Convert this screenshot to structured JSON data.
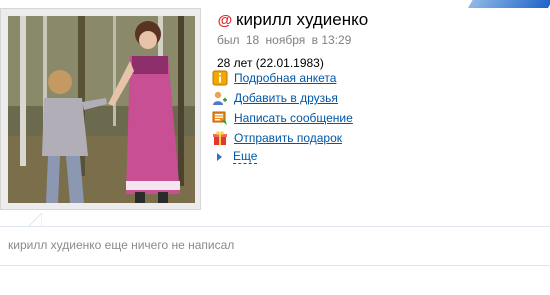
{
  "profile": {
    "name": "кирилл худиенко",
    "last_seen": {
      "prefix": "был",
      "day": "18",
      "month": "ноября",
      "time": "в 13:29"
    },
    "age": "28 лет (22.01.1983)"
  },
  "actions": [
    {
      "label": "Подробная анкета",
      "icon": "info-icon"
    },
    {
      "label": "Добавить в друзья",
      "icon": "add-friend-icon"
    },
    {
      "label": "Написать сообщение",
      "icon": "message-icon"
    },
    {
      "label": "Отправить подарок",
      "icon": "gift-icon"
    }
  ],
  "more_label": "Еще",
  "status_text": "кирилл худиенко еще ничего не написал",
  "colors": {
    "link": "#0057a8",
    "name_icon": "#e0282c",
    "muted_text": "#808080"
  }
}
